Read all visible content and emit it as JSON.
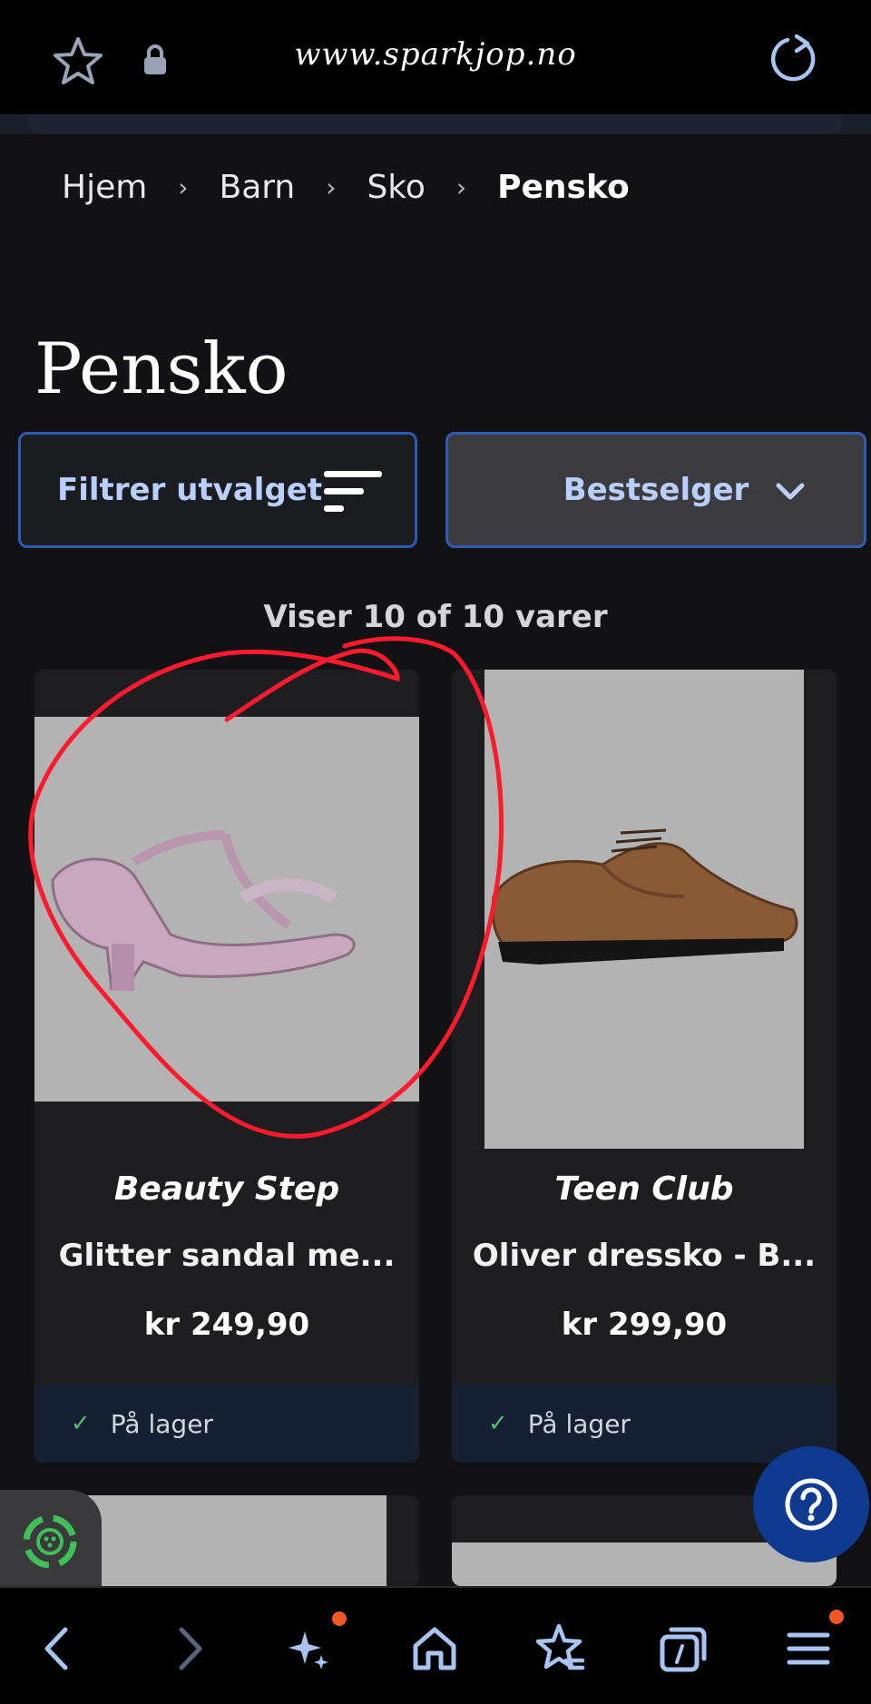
{
  "browser": {
    "url": "www.sparkjop.no"
  },
  "breadcrumb": {
    "items": [
      "Hjem",
      "Barn",
      "Sko"
    ],
    "current": "Pensko"
  },
  "page": {
    "title": "Pensko",
    "filter_label": "Filtrer utvalget",
    "sort_label": "Bestselger",
    "count_text": "Viser 10 of 10 varer"
  },
  "products": [
    {
      "brand": "Beauty Step",
      "name": "Glitter sandal me...",
      "price": "kr 249,90",
      "stock": "På lager"
    },
    {
      "brand": "Teen Club",
      "name": "Oliver dressko - B...",
      "price": "kr 299,90",
      "stock": "På lager"
    }
  ],
  "colors": {
    "accent": "#2d5bb7",
    "link": "#b9cfff",
    "stock_check": "#4fbf6c",
    "annotation": "#ff1a2e",
    "notification": "#f05a22"
  },
  "icons": {
    "top": [
      "star-icon",
      "lock-icon",
      "reload-icon"
    ],
    "bottom": [
      "back-icon",
      "forward-icon",
      "sparkle-icon",
      "home-icon",
      "bookmarks-icon",
      "tabs-icon",
      "menu-icon"
    ]
  }
}
